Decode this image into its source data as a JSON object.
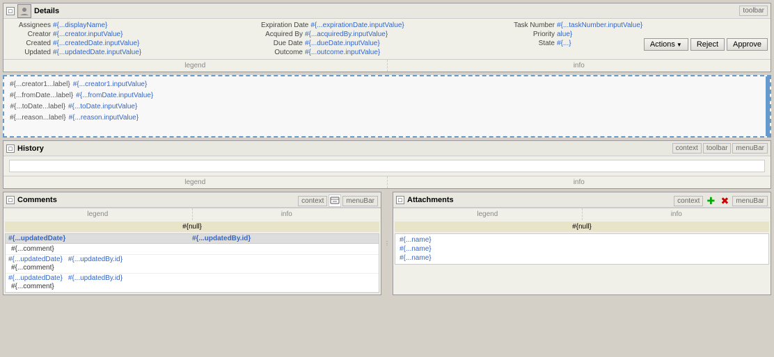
{
  "details": {
    "title": "Details",
    "toolbar_label": "toolbar",
    "footer_left": "legend",
    "footer_right": "info",
    "fields": {
      "col1": [
        {
          "label": "Assignees",
          "value": "#{...displayName}"
        },
        {
          "label": "Creator",
          "value": "#{...creator.inputValue}"
        },
        {
          "label": "Created",
          "value": "#{...createdDate.inputValue}"
        },
        {
          "label": "Updated",
          "value": "#{...updatedDate.inputValue}"
        }
      ],
      "col2": [
        {
          "label": "Expiration Date",
          "value": "#{...expirationDate.inputValue}"
        },
        {
          "label": "Acquired By",
          "value": "#{...acquiredBy.inputValue}"
        },
        {
          "label": "Due Date",
          "value": "#{...dueDate.inputValue}"
        },
        {
          "label": "Outcome",
          "value": "#{...outcome.inputValue}"
        }
      ],
      "col3": [
        {
          "label": "Task Number",
          "value": "#{...taskNumber.inputValue}"
        },
        {
          "label": "Priority",
          "value": "alue}"
        },
        {
          "label": "State",
          "value": "#{...}"
        }
      ]
    }
  },
  "actions": {
    "actions_label": "Actions",
    "reject_label": "Reject",
    "approve_label": "Approve"
  },
  "middle": {
    "rows": [
      {
        "label": "#{...creator1...label}",
        "value": "#{...creator1.inputValue}"
      },
      {
        "label": "#{...fromDate...label}",
        "value": "#{...fromDate.inputValue}"
      },
      {
        "label": "#{...toDate...label}",
        "value": "#{...toDate.inputValue}"
      },
      {
        "label": "#{...reason...label}",
        "value": "#{...reason.inputValue}"
      }
    ]
  },
  "history": {
    "title": "History",
    "context_label": "context",
    "toolbar_label": "toolbar",
    "menubar_label": "menuBar",
    "footer_left": "legend",
    "footer_right": "info"
  },
  "comments": {
    "title": "Comments",
    "context_label": "context",
    "menubar_label": "menuBar",
    "footer_left": "legend",
    "footer_right": "info",
    "null_value": "#{null}",
    "table_header": [
      "#{...updatedDate}",
      "#{...updatedBy.id}"
    ],
    "rows": [
      {
        "col1": "",
        "col2": "",
        "comment": "#{...comment}"
      },
      {
        "col1": "#{...updatedDate}",
        "col2": "#{...updatedBy.id}",
        "comment": "#{...comment}"
      },
      {
        "col1": "#{...updatedDate}",
        "col2": "#{...updatedBy.id}",
        "comment": "#{...comment}"
      }
    ]
  },
  "attachments": {
    "title": "Attachments",
    "context_label": "context",
    "menubar_label": "menuBar",
    "footer_left": "legend",
    "footer_right": "info",
    "null_value": "#{null}",
    "items": [
      "#{...name}",
      "#{...name}",
      "#{...name}"
    ]
  }
}
